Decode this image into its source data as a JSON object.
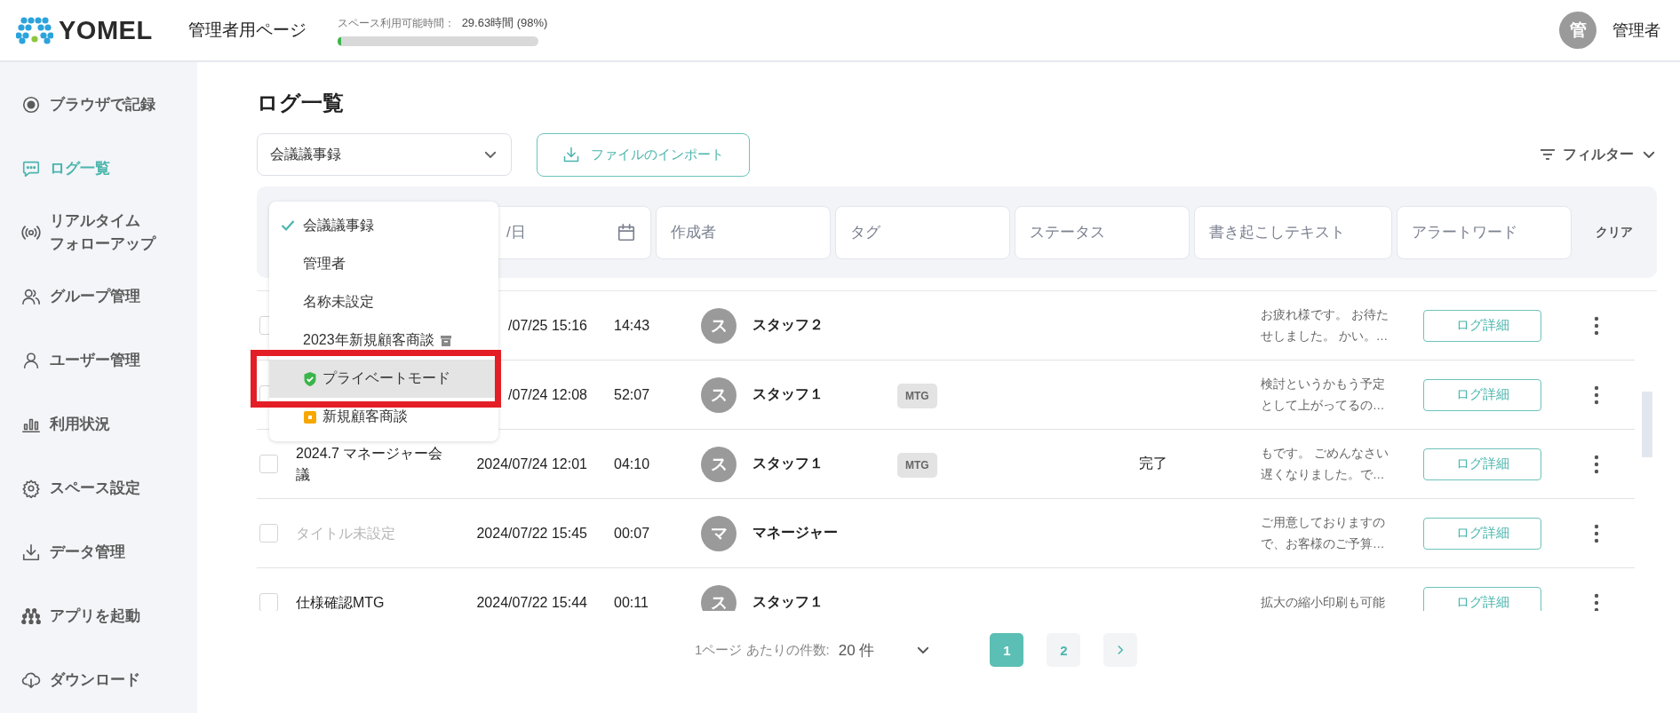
{
  "header": {
    "logo": "YOMEL",
    "page_title": "管理者用ページ",
    "usage": {
      "label": "スペース利用可能時間：",
      "value": "29.63時間 (98%)",
      "level": 0.02
    },
    "user": {
      "avatar": "管",
      "name": "管理者"
    }
  },
  "sidebar": {
    "items": [
      {
        "label": "ブラウザで記録",
        "selected": false
      },
      {
        "label": "ログ一覧",
        "selected": true
      },
      {
        "label": "リアルタイム",
        "label_2": "フォローアップ",
        "selected": false
      },
      {
        "label": "グループ管理",
        "selected": false
      },
      {
        "label": "ユーザー管理",
        "selected": false
      },
      {
        "label": "利用状況",
        "selected": false
      },
      {
        "label": "スペース設定",
        "selected": false
      },
      {
        "label": "データ管理",
        "selected": false
      },
      {
        "label": "アプリを起動",
        "selected": false
      },
      {
        "label": "ダウンロード",
        "selected": false
      }
    ]
  },
  "main": {
    "title": "ログ一覧",
    "selector": {
      "value": "会議議事録"
    },
    "import_button": "ファイルのインポート",
    "filter_button": "フィルター",
    "filters": {
      "fields": [
        {
          "placeholder": "/日"
        },
        {
          "placeholder": "作成者"
        },
        {
          "placeholder": "タグ"
        },
        {
          "placeholder": "ステータス"
        },
        {
          "placeholder": "書き起こしテキスト"
        },
        {
          "placeholder": "アラートワード"
        }
      ],
      "clear": "クリア"
    },
    "rows": [
      {
        "checked": false,
        "date": "/07/25 15:16",
        "duration": "14:43",
        "avatar": "ス",
        "creator": "スタッフ２",
        "summary": [
          "お疲れ様です。 お待た",
          "せしました。 かい。…"
        ],
        "button": "ログ詳細"
      },
      {
        "checked": false,
        "date": "/07/24 12:08",
        "duration": "52:07",
        "avatar": "ス",
        "creator": "スタッフ１",
        "tag": "MTG",
        "summary": [
          "検討というかもう予定",
          "として上がってるの…"
        ],
        "button": "ログ詳細"
      },
      {
        "checked": false,
        "dimmed": false,
        "title": "2024.7 マネージャー会議",
        "date": "2024/07/24 12:01",
        "duration": "04:10",
        "avatar": "ス",
        "creator": "スタッフ１",
        "tag": "MTG",
        "status": "完了",
        "summary": [
          "もです。 ごめんなさい",
          "遅くなりました。で…"
        ],
        "button": "ログ詳細"
      },
      {
        "checked": false,
        "dimmed": true,
        "title": "タイトル未設定",
        "date": "2024/07/22 15:45",
        "duration": "00:07",
        "avatar": "マ",
        "creator": "マネージャー",
        "summary": [
          "ご用意しておりますの",
          "で、お客様のご予算…"
        ],
        "button": "ログ詳細"
      },
      {
        "checked": false,
        "dimmed": false,
        "title": "仕様確認MTG",
        "date": "2024/07/22 15:44",
        "duration": "00:11",
        "avatar": "ス",
        "creator": "スタッフ１",
        "summary": [
          "拡大の縮小印刷も可能"
        ],
        "button": "ログ詳細"
      }
    ],
    "pagination": {
      "per_page_label": "1ページ あたりの件数:",
      "per_page_value": "20 件",
      "pages": [
        {
          "label": "1",
          "selected": true
        },
        {
          "label": "2",
          "selected": false
        }
      ]
    },
    "dropdown": {
      "items": [
        {
          "label": "会議議事録",
          "kind": "plain",
          "selected": true,
          "highlighted": false,
          "annotated": false
        },
        {
          "label": "管理者",
          "kind": "plain",
          "selected": false,
          "highlighted": false,
          "annotated": false
        },
        {
          "label": "名称未設定",
          "kind": "plain",
          "selected": false,
          "highlighted": false,
          "annotated": false
        },
        {
          "label": "2023年新規顧客商談",
          "kind": "archived",
          "selected": false,
          "highlighted": false,
          "annotated": false
        },
        {
          "label": "プライベートモード",
          "kind": "private",
          "selected": false,
          "highlighted": true,
          "annotated": true
        },
        {
          "label": "新規顧客商談",
          "kind": "locked",
          "selected": false,
          "highlighted": false,
          "annotated": false
        }
      ]
    }
  }
}
